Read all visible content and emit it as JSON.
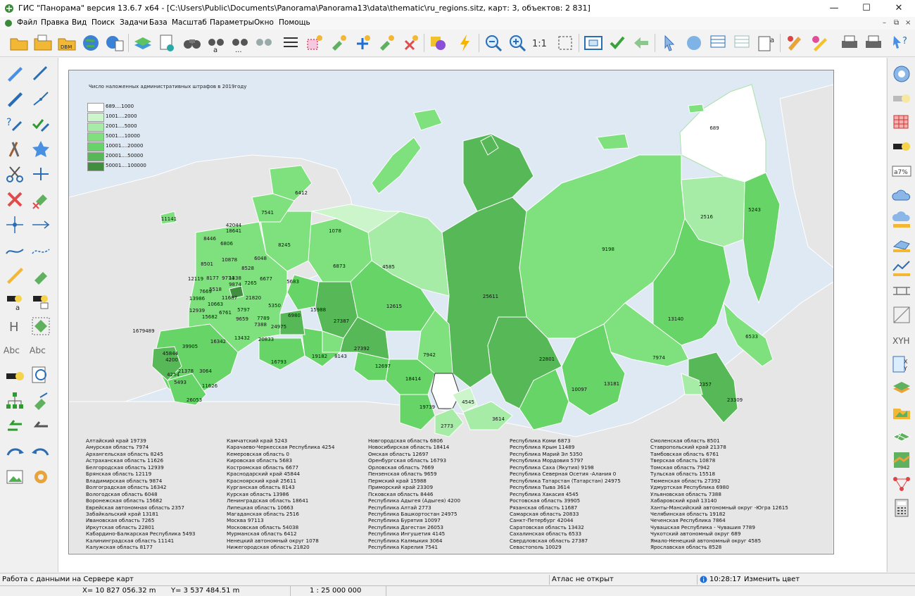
{
  "window": {
    "title": "ГИС \"Панорама\" версия 13.6.7 x64 - [C:\\Users\\Public\\Documents\\Panorama\\Panorama13\\data\\thematic\\ru_regions.sitz, карт: 3, объектов: 2 831]",
    "minimize": "—",
    "maximize": "☐",
    "close": "✕",
    "mdi_min": "–",
    "mdi_restore": "⧉",
    "mdi_close": "×"
  },
  "menu": [
    "Файл",
    "Правка",
    "Вид",
    "Поиск",
    "Задачи",
    "База",
    "Масштаб",
    "Параметры",
    "Окно",
    "Помощь"
  ],
  "toolbar": {
    "scale_label": "1:1",
    "dbm_label": "DBM"
  },
  "tools": {
    "height_label": "H",
    "abc1": "Abc",
    "abc2": "Abc",
    "xyh": "XYH",
    "a7": "a7%"
  },
  "legend": {
    "title": "Число наложенных административных штрафов в 2019году",
    "items": [
      {
        "label": "689....1000",
        "color": "#ffffff"
      },
      {
        "label": "1001....2000",
        "color": "#ccf5cc"
      },
      {
        "label": "2001....5000",
        "color": "#a6eca6"
      },
      {
        "label": "5001....10000",
        "color": "#7ee17e"
      },
      {
        "label": "10001....20000",
        "color": "#66d466"
      },
      {
        "label": "20001....50000",
        "color": "#57b857"
      },
      {
        "label": "50001....100000",
        "color": "#3f8f3f"
      }
    ]
  },
  "map_labels": [
    "689",
    "5243",
    "2516",
    "9198",
    "13140",
    "6533",
    "7974",
    "23309",
    "2357",
    "13181",
    "10097",
    "22801",
    "25611",
    "7942",
    "18414",
    "19739",
    "4545",
    "3614",
    "2773",
    "12697",
    "27392",
    "12615",
    "27387",
    "4585",
    "6873",
    "1078",
    "6412",
    "7541",
    "11141",
    "42044",
    "18641",
    "8245",
    "6806",
    "8446",
    "10878",
    "6048",
    "8501",
    "8528",
    "6677",
    "12119",
    "8177",
    "9774",
    "1338",
    "5683",
    "13986",
    "7669",
    "9874",
    "7265",
    "5518",
    "11687",
    "21820",
    "12939",
    "10663",
    "5350",
    "6761",
    "5797",
    "6980",
    "15988",
    "15682",
    "9659",
    "7789",
    "7388",
    "24975",
    "16342",
    "13432",
    "20833",
    "1679489",
    "39905",
    "45844",
    "4200",
    "21378",
    "4254",
    "3064",
    "5493",
    "11626",
    "26053",
    "16793",
    "19182",
    "8143"
  ],
  "stats": {
    "col1": [
      "Алтайский край  19739",
      "Амурская область  7974",
      "Архангельская область  8245",
      "Астраханская область  11626",
      "Белгородская область  12939",
      "Брянская область  12119",
      "Владимирская область  9874",
      "Волгоградская область  16342",
      "Вологодская область  6048",
      "Воронежская область  15682",
      "Еврейская автономная область  2357",
      "Забайкальский край  13181",
      "Ивановская область  7265",
      "Иркутская область  22801",
      "Кабардино-Балкарская Республика  5493",
      "Калининградская область  11141",
      "Калужская область  8177"
    ],
    "col2": [
      "Камчатский край  5243",
      "Карачаево-Черкесская Республика  4254",
      "Кемеровская область  0",
      "Кировская область  5683",
      "Костромская область  6677",
      "Краснодарский край  45844",
      "Красноярский край  25611",
      "Курганская область  8143",
      "Курская область  13986",
      "Ленинградская область  18641",
      "Липецкая область  10663",
      "Магаданская область  2516",
      "Москва  97113",
      "Московская область  54038",
      "Мурманская область  6412",
      "Ненецкий автономный округ  1078",
      "Нижегородская область  21820"
    ],
    "col3": [
      "Новгородская область  6806",
      "Новосибирская область  18414",
      "Омская область  12697",
      "Оренбургская область  16793",
      "Орловская область  7669",
      "Пензенская область  9659",
      "Пермский край  15988",
      "Приморский край  23309",
      "Псковская область  8446",
      "Республика Адыгея (Адыгея) 4200",
      "Республика Алтай  2773",
      "Республика Башкортостан  24975",
      "Республика Бурятия  10097",
      "Республика Дагестан  26053",
      "Республика Ингушетия  4145",
      "Республика Калмыкия  3064",
      "Республика Карелия  7541"
    ],
    "col4": [
      "Республика Коми  6873",
      "Республика Крым  11489",
      "Республика Марий Эл  5350",
      "Республика Мордовия  5797",
      "Республика Саха (Якутия) 9198",
      "Республика Северная Осетия -Алания  0",
      "Республика Татарстан (Татарстан) 24975",
      "Республика Тыва  3614",
      "Республика Хакасия  4545",
      "Ростовская область  39905",
      "Рязанская область  11687",
      "Самарская область  20833",
      "Санкт-Петербург  42044",
      "Саратовская область  13432",
      "Сахалинская область  6533",
      "Свердловская область  27387",
      "Севастополь  10029"
    ],
    "col5": [
      "Смоленская область  8501",
      "Ставропольский край  21378",
      "Тамбовская область  6761",
      "Тверская область  10878",
      "Томская область  7942",
      "Тульская область  15518",
      "Тюменская область  27392",
      "Удмуртская Республика  6980",
      "Ульяновская область  7388",
      "Хабаровский край  13140",
      "Ханты-Мансийский автономный округ -Югра  12615",
      "Челябинская область  19182",
      "Чеченская Республика  7864",
      "Чувашская Республика - Чувашия  7789",
      "Чукотский автономный округ  689",
      "Ямало-Ненецкий автономный округ  4585",
      "Ярославская область  8528"
    ]
  },
  "status": {
    "left": "Работа с данными на Сервере карт",
    "atlas": "Атлас не открыт",
    "time": "10:28:17",
    "info": "Изменить цвет",
    "x": "X= 10 827 056.32 m",
    "y": "Y= 3 537 484.51 m",
    "scale": "1 : 25 000 000"
  },
  "colors": {
    "land": "#e6e6e6",
    "water": "#dfe9f3",
    "border": "#ffffff",
    "accent_green": "#57b857"
  }
}
